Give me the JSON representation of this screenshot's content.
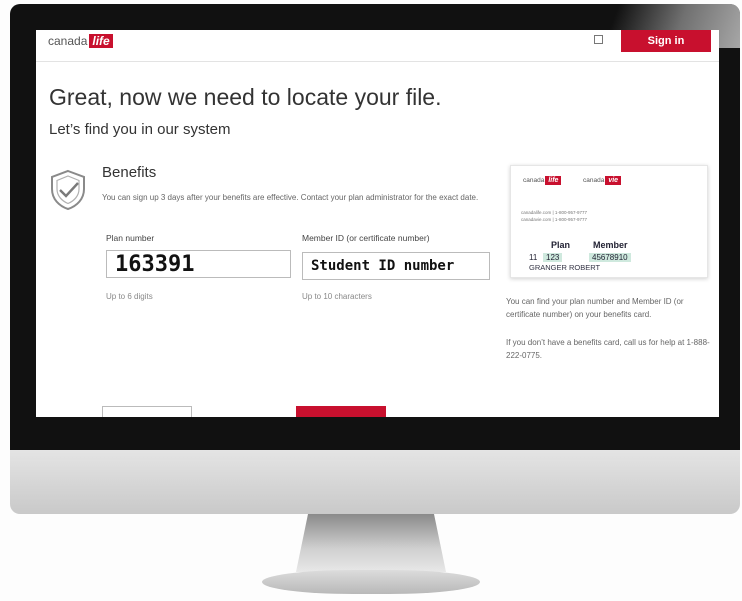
{
  "header": {
    "logo_text": "canada",
    "logo_badge": "life",
    "signin_label": "Sign in"
  },
  "main": {
    "title": "Great, now we need to locate your file.",
    "subtitle": "Let’s find you in our system",
    "benefits": {
      "title": "Benefits",
      "description": "You can sign up 3 days after your benefits are effective. Contact your plan administrator for the exact date."
    },
    "plan_field": {
      "label": "Plan number",
      "value": "163391",
      "hint": "Up to 6 digits"
    },
    "member_field": {
      "label": "Member ID (or certificate number)",
      "value": "Student ID number",
      "hint": "Up to 10 characters"
    }
  },
  "card": {
    "logo1_text": "canada",
    "logo1_badge": "life",
    "logo2_text": "canada",
    "logo2_badge": "vie",
    "small_line1": "canadalife.com | 1-800-957-9777",
    "small_line2": "canadavie.com | 1-800-957-9777",
    "plan_heading": "Plan",
    "member_heading": "Member",
    "row_prefix": "11",
    "plan_value": "123",
    "member_value": "45678910",
    "holder_name": "GRANGER ROBERT"
  },
  "sidebar": {
    "help1": "You can find your plan number and Member ID (or certificate number) on your benefits card.",
    "help2": "If you don’t have a benefits card, call us for help at 1-888-222-0775."
  },
  "colors": {
    "brand_red": "#c8102e",
    "highlight": "#cfe9de"
  },
  "icons": {
    "benefits": "shield-check-icon",
    "language": "language-icon"
  }
}
